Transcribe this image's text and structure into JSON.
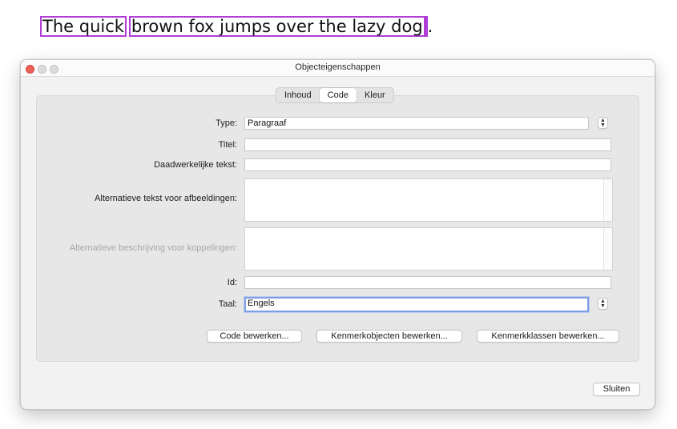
{
  "document": {
    "words_part1": "The quick",
    "words_part2": "brown fox jumps over the lazy dog",
    "punct": "."
  },
  "window": {
    "title": "Objecteigenschappen",
    "tabs": [
      {
        "label": "Inhoud"
      },
      {
        "label": "Code"
      },
      {
        "label": "Kleur"
      }
    ],
    "active_tab": "Code"
  },
  "form": {
    "type_label": "Type:",
    "type_value": "Paragraaf",
    "title_label": "Titel:",
    "title_value": "",
    "actual_text_label": "Daadwerkelijke tekst:",
    "actual_text_value": "",
    "alt_text_label": "Alternatieve tekst voor afbeeldingen:",
    "alt_desc_label": "Alternatieve beschrijving voor koppelingen:",
    "id_label": "Id:",
    "id_value": "",
    "lang_label": "Taal:",
    "lang_value": "Engels"
  },
  "buttons": {
    "edit_code": "Code bewerken...",
    "edit_attr_objects": "Kenmerkobjecten bewerken...",
    "edit_attr_classes": "Kenmerkklassen bewerken...",
    "close": "Sluiten"
  },
  "colors": {
    "highlight_box": "#b13cd6",
    "focus_ring": "#7f9ee6",
    "close_button": "#ec5f55"
  },
  "icons": {
    "select_arrows": "updown-chevron-icon"
  }
}
